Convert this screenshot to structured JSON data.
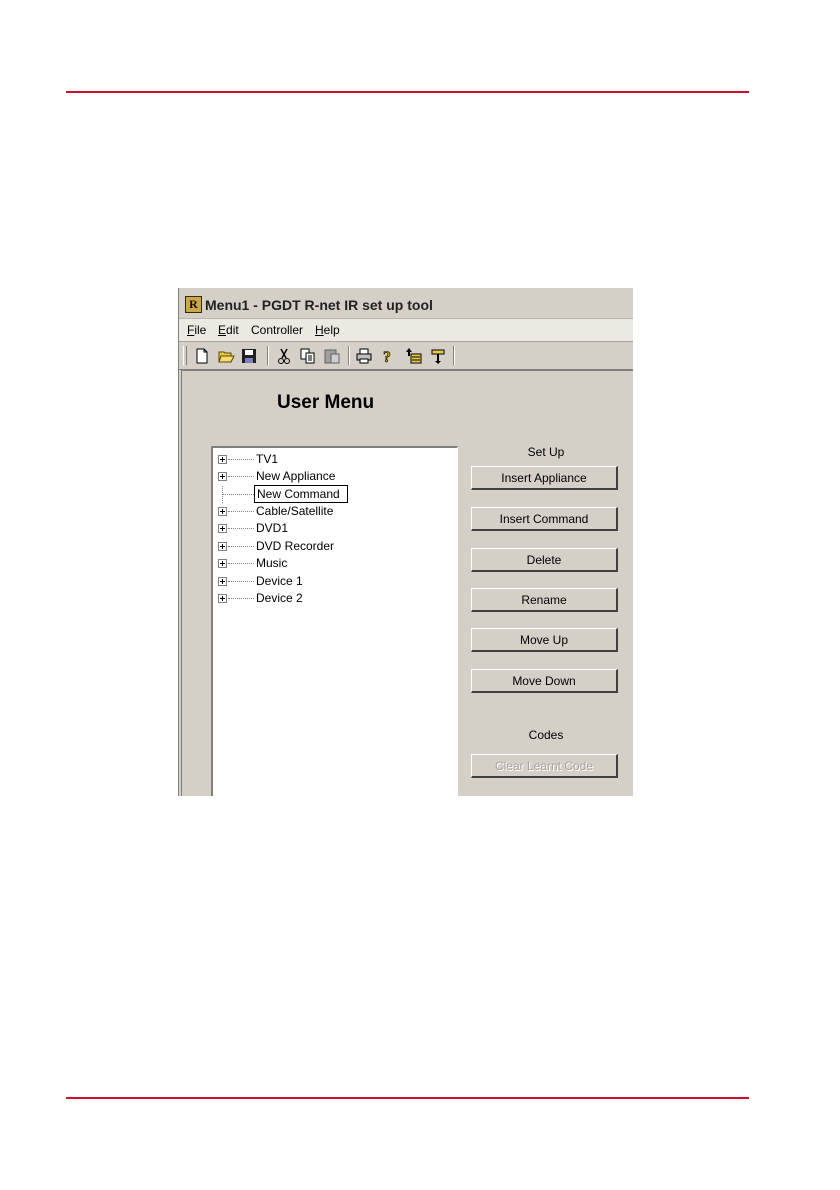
{
  "window": {
    "title": "Menu1 - PGDT R-net IR set up tool",
    "app_icon_letter": "R"
  },
  "menubar": [
    {
      "key": "F",
      "rest": "ile"
    },
    {
      "key": "E",
      "rest": "dit"
    },
    {
      "key": "",
      "rest": "Controller"
    },
    {
      "key": "H",
      "rest": "elp"
    }
  ],
  "toolbar": [
    "new-icon",
    "open-icon",
    "save-icon",
    "cut-icon",
    "copy-icon",
    "paste-icon",
    "print-icon",
    "help-icon",
    "move-up-icon",
    "move-down-icon"
  ],
  "main": {
    "heading": "User Menu",
    "tree": [
      {
        "label": "TV1",
        "expandable": true
      },
      {
        "label": "New Appliance",
        "expandable": true
      },
      {
        "label": "New Command",
        "expandable": false,
        "editing": true
      },
      {
        "label": "Cable/Satellite",
        "expandable": true
      },
      {
        "label": "DVD1",
        "expandable": true
      },
      {
        "label": "DVD Recorder",
        "expandable": true
      },
      {
        "label": "Music",
        "expandable": true
      },
      {
        "label": "Device 1",
        "expandable": true
      },
      {
        "label": "Device 2",
        "expandable": true
      }
    ],
    "setup": {
      "label": "Set Up",
      "buttons": {
        "insert_appliance": "Insert Appliance",
        "insert_command": "Insert Command",
        "delete": "Delete",
        "rename": "Rename",
        "move_up": "Move Up",
        "move_down": "Move Down"
      }
    },
    "codes": {
      "label": "Codes",
      "clear_learnt_code": "Clear Learnt Code"
    }
  }
}
